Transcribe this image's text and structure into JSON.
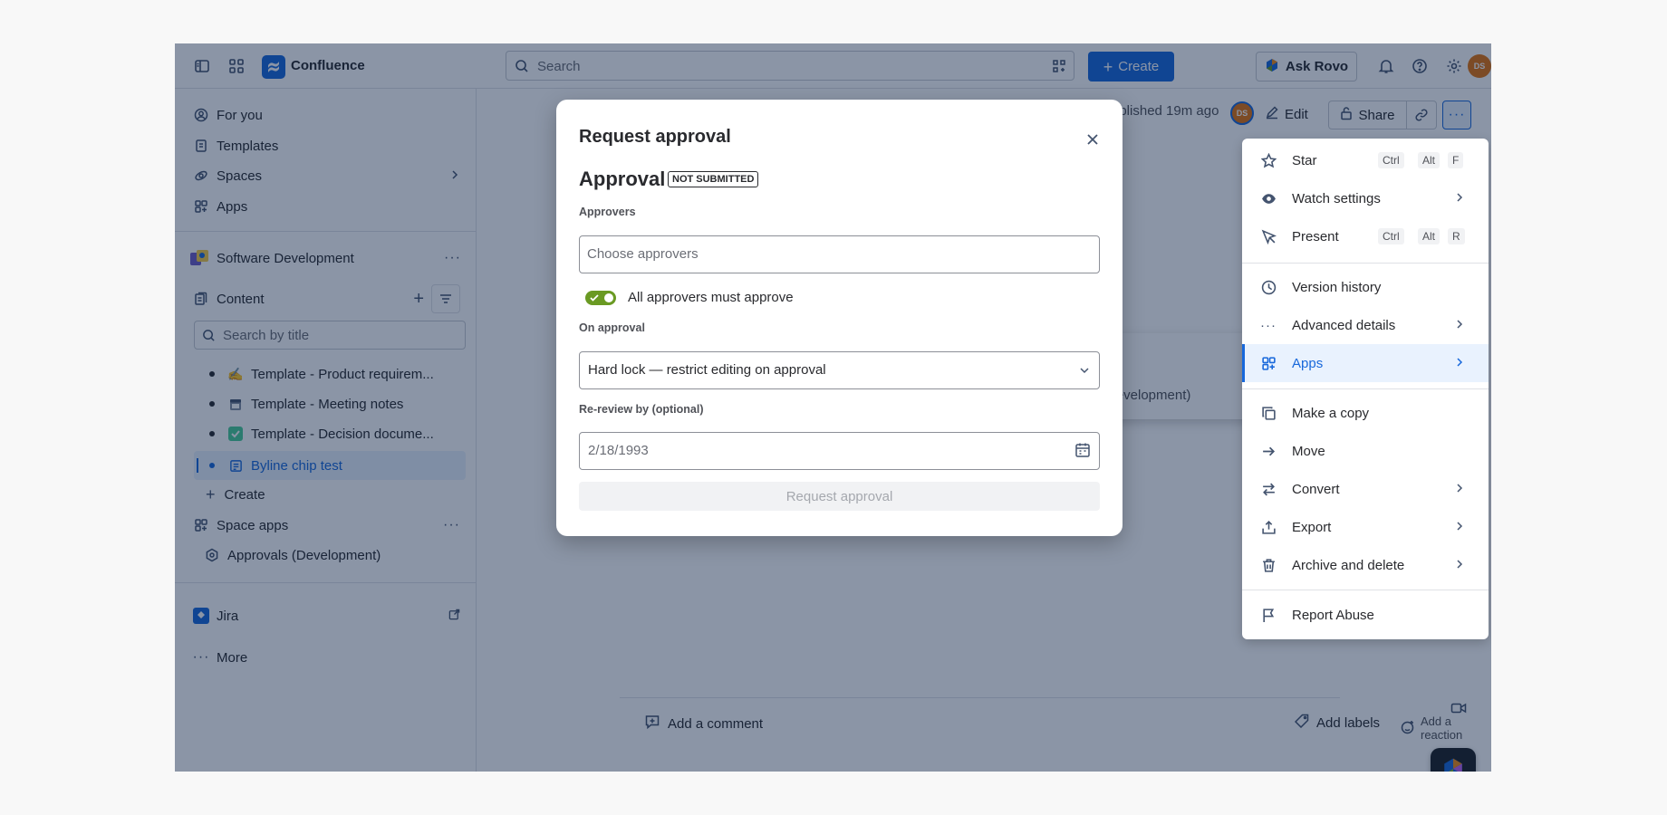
{
  "topbar": {
    "app_name": "Confluence",
    "search_placeholder": "Search",
    "create_label": "Create",
    "rovo_label": "Ask Rovo",
    "avatar_initials": "DS"
  },
  "sidebar": {
    "nav": [
      {
        "label": "For you",
        "icon": "person-circle-icon"
      },
      {
        "label": "Templates",
        "icon": "templates-icon"
      },
      {
        "label": "Spaces",
        "icon": "spaces-icon"
      },
      {
        "label": "Apps",
        "icon": "apps-grid-icon"
      }
    ],
    "space_name": "Software Development",
    "content_label": "Content",
    "search_title_placeholder": "Search by title",
    "tree": [
      {
        "label": "Template - Product requirem...",
        "emoji": "✍️"
      },
      {
        "label": "Template - Meeting notes",
        "emoji": "🗓"
      },
      {
        "label": "Template - Decision docume...",
        "emoji": "✅"
      },
      {
        "label": "Byline chip test",
        "emoji": "page"
      }
    ],
    "create_label": "Create",
    "space_apps_label": "Space apps",
    "approvals_app_label": "Approvals (Development)",
    "jira_label": "Jira",
    "more_label": "More"
  },
  "page_header": {
    "published_text": "ublished 19m ago",
    "edit_label": "Edit",
    "share_label": "Share"
  },
  "background_popover": {
    "line1": "s",
    "line2": "(Development)"
  },
  "footer": {
    "add_comment": "Add a comment",
    "add_labels": "Add labels",
    "add_reaction": "Add a reaction"
  },
  "modal": {
    "title": "Request approval",
    "section_title": "Approval",
    "status_badge": "NOT SUBMITTED",
    "approvers_label": "Approvers",
    "approvers_placeholder": "Choose approvers",
    "toggle_label": "All approvers must approve",
    "toggle_on": true,
    "on_approval_label": "On approval",
    "on_approval_value": "Hard lock — restrict editing on approval",
    "rereview_label": "Re-review by (optional)",
    "rereview_placeholder": "2/18/1993",
    "submit_label": "Request approval"
  },
  "more_menu": {
    "items": [
      {
        "label": "Star",
        "icon": "star-icon",
        "keys": [
          "Ctrl",
          "Alt",
          "F"
        ]
      },
      {
        "label": "Watch settings",
        "icon": "eye-icon",
        "submenu": true
      },
      {
        "label": "Present",
        "icon": "present-icon",
        "keys": [
          "Ctrl",
          "Alt",
          "R"
        ]
      },
      {
        "label": "Version history",
        "icon": "clock-icon"
      },
      {
        "label": "Advanced details",
        "icon": "ellipsis-icon",
        "submenu": true
      },
      {
        "label": "Apps",
        "icon": "apps-icon",
        "submenu": true,
        "selected": true
      },
      {
        "label": "Make a copy",
        "icon": "copy-icon"
      },
      {
        "label": "Move",
        "icon": "arrow-right-icon"
      },
      {
        "label": "Convert",
        "icon": "convert-icon",
        "submenu": true
      },
      {
        "label": "Export",
        "icon": "export-icon",
        "submenu": true
      },
      {
        "label": "Archive and delete",
        "icon": "trash-icon",
        "submenu": true
      },
      {
        "label": "Report Abuse",
        "icon": "flag-icon"
      }
    ]
  },
  "colors": {
    "brand_blue": "#1868db",
    "toggle_green": "#6a9a23",
    "avatar_orange": "#e2740f",
    "selected_bg": "#e9f2fe"
  }
}
